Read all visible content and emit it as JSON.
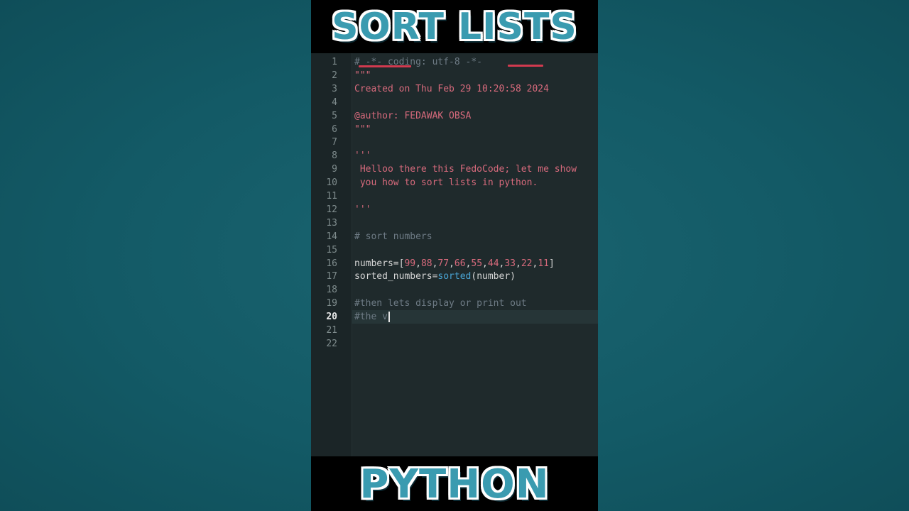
{
  "banner": {
    "top": "SORT LISTS",
    "bottom": "PYTHON"
  },
  "editor": {
    "current_line": 20,
    "lines": [
      {
        "n": "1",
        "segs": [
          {
            "t": "# -*- coding: utf-8 -*-",
            "c": "comment"
          }
        ]
      },
      {
        "n": "2",
        "segs": [
          {
            "t": "\"\"\"",
            "c": "string"
          }
        ]
      },
      {
        "n": "3",
        "segs": [
          {
            "t": "Created on Thu Feb 29 10:20:58 2024",
            "c": "string"
          }
        ]
      },
      {
        "n": "4",
        "segs": []
      },
      {
        "n": "5",
        "segs": [
          {
            "t": "@author: FEDAWAK OBSA",
            "c": "string"
          }
        ]
      },
      {
        "n": "6",
        "segs": [
          {
            "t": "\"\"\"",
            "c": "string"
          }
        ]
      },
      {
        "n": "7",
        "segs": []
      },
      {
        "n": "8",
        "segs": [
          {
            "t": "'''",
            "c": "string"
          }
        ]
      },
      {
        "n": "9",
        "segs": [
          {
            "t": " Helloo there this FedoCode; let me show",
            "c": "string"
          }
        ]
      },
      {
        "n": "10",
        "segs": [
          {
            "t": " you how to sort lists in python.",
            "c": "string"
          }
        ]
      },
      {
        "n": "11",
        "segs": []
      },
      {
        "n": "12",
        "segs": [
          {
            "t": "'''",
            "c": "string"
          }
        ]
      },
      {
        "n": "13",
        "segs": []
      },
      {
        "n": "14",
        "segs": [
          {
            "t": "# sort numbers",
            "c": "comment"
          }
        ]
      },
      {
        "n": "15",
        "segs": []
      },
      {
        "n": "16",
        "segs": [
          {
            "t": "numbers=[",
            "c": "default"
          },
          {
            "t": "99",
            "c": "num"
          },
          {
            "t": ",",
            "c": "default"
          },
          {
            "t": "88",
            "c": "num"
          },
          {
            "t": ",",
            "c": "default"
          },
          {
            "t": "77",
            "c": "num"
          },
          {
            "t": ",",
            "c": "default"
          },
          {
            "t": "66",
            "c": "num"
          },
          {
            "t": ",",
            "c": "default"
          },
          {
            "t": "55",
            "c": "num"
          },
          {
            "t": ",",
            "c": "default"
          },
          {
            "t": "44",
            "c": "num"
          },
          {
            "t": ",",
            "c": "default"
          },
          {
            "t": "33",
            "c": "num"
          },
          {
            "t": ",",
            "c": "default"
          },
          {
            "t": "22",
            "c": "num"
          },
          {
            "t": ",",
            "c": "default"
          },
          {
            "t": "11",
            "c": "num"
          },
          {
            "t": "]",
            "c": "default"
          }
        ]
      },
      {
        "n": "17",
        "segs": [
          {
            "t": "sorted_numbers=",
            "c": "default"
          },
          {
            "t": "sorted",
            "c": "builtin"
          },
          {
            "t": "(number)",
            "c": "default"
          }
        ]
      },
      {
        "n": "18",
        "segs": []
      },
      {
        "n": "19",
        "segs": [
          {
            "t": "#then lets display or print out",
            "c": "comment"
          }
        ]
      },
      {
        "n": "20",
        "segs": [
          {
            "t": "#the v",
            "c": "comment"
          }
        ]
      },
      {
        "n": "21",
        "segs": []
      },
      {
        "n": "22",
        "segs": []
      }
    ]
  },
  "colors": {
    "background": "#135a66",
    "editor_bg": "#1f2a2c",
    "string": "#d76a7c",
    "comment": "#6e7b85",
    "builtin": "#4aa6d6",
    "annotation": "#d23a4f"
  }
}
